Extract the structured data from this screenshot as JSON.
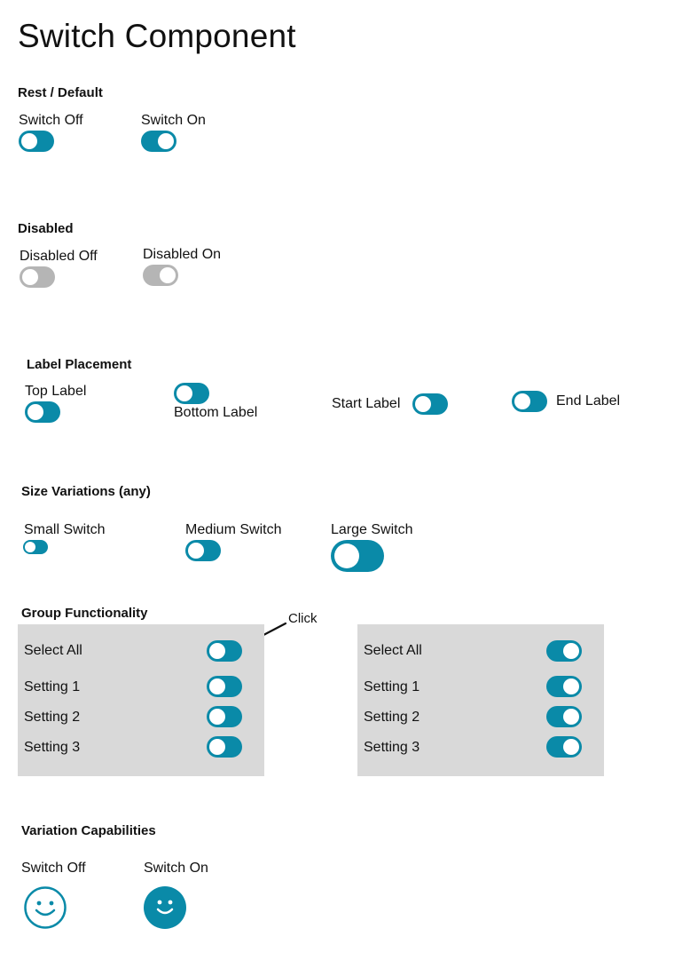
{
  "page": {
    "title": "Switch Component"
  },
  "colors": {
    "accent": "#0a8aa8",
    "disabled": "#b5b5b5",
    "panel": "#d9d9d9"
  },
  "rest": {
    "heading": "Rest / Default",
    "off": {
      "label": "Switch Off",
      "state": "off"
    },
    "on": {
      "label": "Switch On",
      "state": "on"
    }
  },
  "disabled": {
    "heading": "Disabled",
    "off": {
      "label": "Disabled Off",
      "state": "off"
    },
    "on": {
      "label": "Disabled On",
      "state": "on"
    }
  },
  "placement": {
    "heading": "Label Placement",
    "top": "Top Label",
    "bottom": "Bottom Label",
    "start": "Start Label",
    "end": "End Label"
  },
  "sizes": {
    "heading": "Size Variations (any)",
    "small": "Small Switch",
    "medium": "Medium Switch",
    "large": "Large Switch"
  },
  "group": {
    "heading": "Group Functionality",
    "annotation": "Click",
    "panels": [
      {
        "state": "off",
        "select_all": "Select All",
        "settings": [
          "Setting 1",
          "Setting 2",
          "Setting 3"
        ]
      },
      {
        "state": "on",
        "select_all": "Select All",
        "settings": [
          "Setting 1",
          "Setting 2",
          "Setting 3"
        ]
      }
    ]
  },
  "variation": {
    "heading": "Variation Capabilities",
    "off": {
      "label": "Switch Off",
      "icon": "smiley-outline-icon"
    },
    "on": {
      "label": "Switch On",
      "icon": "smiley-filled-icon"
    }
  }
}
